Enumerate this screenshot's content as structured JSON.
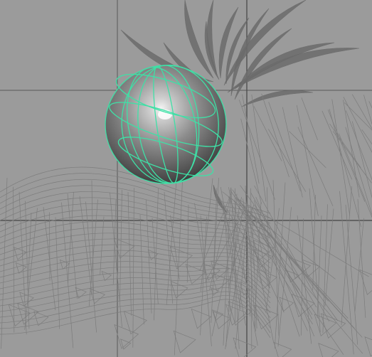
{
  "viewport": {
    "view": "perspective",
    "shading": "wireframe-on-shaded",
    "background_color": "#9b9b9b",
    "grid_color": "#555555",
    "wireframe_color": "#7c7c7c",
    "foliage_color": "#6c6c6c",
    "selection_wire_color": "#3fe0a6",
    "sphere_colors": {
      "highlight": "#f2f2f2",
      "mid": "#8a8a8a",
      "shadow": "#2c2c2c"
    }
  },
  "objects": [
    {
      "name": "sphere",
      "type": "nurbs-sphere",
      "selected": true
    },
    {
      "name": "plant-leaves",
      "type": "mesh",
      "selected": false
    },
    {
      "name": "hand-mesh",
      "type": "mesh",
      "selected": false
    }
  ]
}
